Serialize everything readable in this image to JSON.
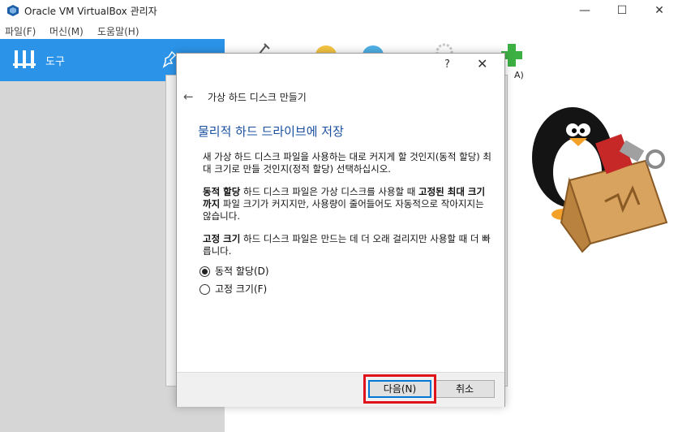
{
  "window": {
    "title": "Oracle VM VirtualBox 관리자",
    "min_glyph": "—",
    "max_glyph": "☐",
    "close_glyph": "✕"
  },
  "menu": {
    "items": [
      "파일(F)",
      "머신(M)",
      "도움말(H)"
    ]
  },
  "sidebar": {
    "tools_label": "도구",
    "accent": "#2b93e8"
  },
  "toolbar": {
    "label_fragment": "A)"
  },
  "dialog": {
    "help": "?",
    "close": "✕",
    "back": "←",
    "title": "가상 하드 디스크 만들기",
    "heading": "물리적 하드 드라이브에 저장",
    "para1": "새 가상 하드 디스크 파일을 사용하는 대로 커지게 할 것인지(동적 할당) 최대 크기로 만들 것인지(정적 할당) 선택하십시오.",
    "para2": {
      "b1": "동적 할당",
      "t1": " 하드 디스크 파일은 가상 디스크를 사용할 때 ",
      "b2": "고정된 최대 크기까지",
      "t2": " 파일 크기가 커지지만, 사용량이 줄어들어도 자동적으로 작아지지는 않습니다."
    },
    "para3": {
      "b1": "고정 크기",
      "t1": " 하드 디스크 파일은 만드는 데 더 오래 걸리지만 사용할 때 더 빠릅니다."
    },
    "options": [
      {
        "label": "동적 할당(D)",
        "selected": true
      },
      {
        "label": "고정 크기(F)",
        "selected": false
      }
    ],
    "next_button": "다음(N)",
    "cancel_button": "취소",
    "highlight_color": "#e0131c"
  }
}
